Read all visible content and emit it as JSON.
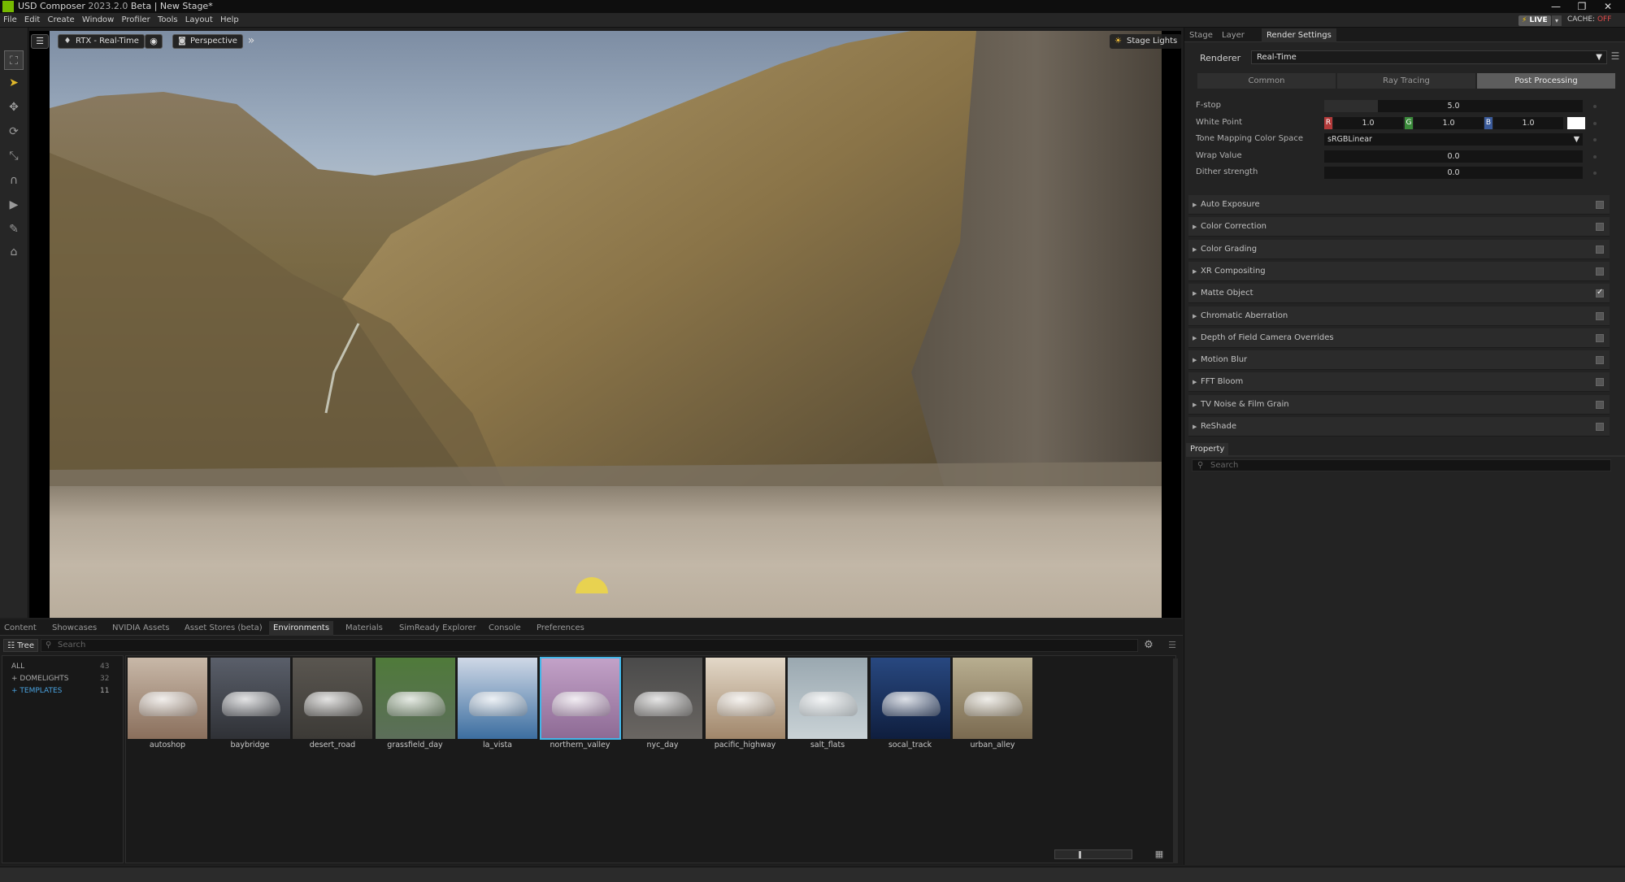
{
  "window": {
    "app_name": "USD Composer",
    "version": "2023.2.0",
    "stage_name": "Beta | New Stage*",
    "minimize": "—",
    "restore": "❐",
    "close": "✕"
  },
  "menu": [
    "File",
    "Edit",
    "Create",
    "Window",
    "Profiler",
    "Tools",
    "Layout",
    "Help"
  ],
  "status": {
    "live": "LIVE",
    "cache_label": "CACHE:",
    "cache_value": "OFF"
  },
  "viewport": {
    "renderer_button": "RTX - Real-Time",
    "camera_button": "Perspective",
    "stage_lights": "Stage Lights"
  },
  "right_panel": {
    "tabs": [
      "Stage",
      "Layer",
      "Render Settings"
    ],
    "active_tab": "Render Settings",
    "renderer_label": "Renderer",
    "renderer_value": "Real-Time",
    "subtabs": [
      "Common",
      "Ray Tracing",
      "Post Processing"
    ],
    "active_subtab": "Post Processing",
    "fstop_label": "F-stop",
    "fstop_value": "5.0",
    "white_point_label": "White Point",
    "white_point": {
      "r_label": "R",
      "r": "1.0",
      "g_label": "G",
      "g": "1.0",
      "b_label": "B",
      "b": "1.0"
    },
    "tone_mapping_label": "Tone Mapping Color Space",
    "tone_mapping_value": "sRGBLinear",
    "wrap_label": "Wrap Value",
    "wrap_value": "0.0",
    "dither_label": "Dither strength",
    "dither_value": "0.0",
    "sections": [
      {
        "label": "Auto Exposure",
        "checked": false
      },
      {
        "label": "Color Correction",
        "checked": false
      },
      {
        "label": "Color Grading",
        "checked": false
      },
      {
        "label": "XR Compositing",
        "checked": false
      },
      {
        "label": "Matte Object",
        "checked": true
      },
      {
        "label": "Chromatic Aberration",
        "checked": false
      },
      {
        "label": "Depth of Field Camera Overrides",
        "checked": false
      },
      {
        "label": "Motion Blur",
        "checked": false
      },
      {
        "label": "FFT Bloom",
        "checked": false
      },
      {
        "label": "TV Noise & Film Grain",
        "checked": false
      },
      {
        "label": "ReShade",
        "checked": false
      }
    ],
    "property_tab": "Property",
    "property_search_placeholder": "Search"
  },
  "bottom_panel": {
    "tabs": [
      "Content",
      "Showcases",
      "NVIDIA Assets",
      "Asset Stores (beta)",
      "Environments",
      "Materials",
      "SimReady Explorer",
      "Console",
      "Preferences"
    ],
    "active_tab": "Environments",
    "tree_button": "Tree",
    "search_placeholder": "Search",
    "tree_items": [
      {
        "label": "ALL",
        "count": "43"
      },
      {
        "label": "+ DOMELIGHTS",
        "count": "32"
      },
      {
        "label": "+ TEMPLATES",
        "count": "11"
      }
    ],
    "thumbnails": [
      {
        "name": "autoshop",
        "bg1": "#c8b8a8",
        "bg2": "#8a6f5c"
      },
      {
        "name": "baybridge",
        "bg1": "#5a5f6a",
        "bg2": "#2f3136"
      },
      {
        "name": "desert_road",
        "bg1": "#5a5650",
        "bg2": "#3c3a36"
      },
      {
        "name": "grassfield_day",
        "bg1": "#4f7a3a",
        "bg2": "#5c6e5a"
      },
      {
        "name": "la_vista",
        "bg1": "#cfd8e6",
        "bg2": "#3c6ea0"
      },
      {
        "name": "northern_valley",
        "bg1": "#c3a2c8",
        "bg2": "#8d6a94"
      },
      {
        "name": "nyc_day",
        "bg1": "#4a4a4a",
        "bg2": "#6a6662"
      },
      {
        "name": "pacific_highway",
        "bg1": "#e3d8c8",
        "bg2": "#a0866a"
      },
      {
        "name": "salt_flats",
        "bg1": "#9aa8b0",
        "bg2": "#c9d2d6"
      },
      {
        "name": "socal_track",
        "bg1": "#284880",
        "bg2": "#0f1e3e"
      },
      {
        "name": "urban_alley",
        "bg1": "#b8ae90",
        "bg2": "#7a6a50"
      }
    ],
    "selected_thumbnail": "northern_valley"
  }
}
